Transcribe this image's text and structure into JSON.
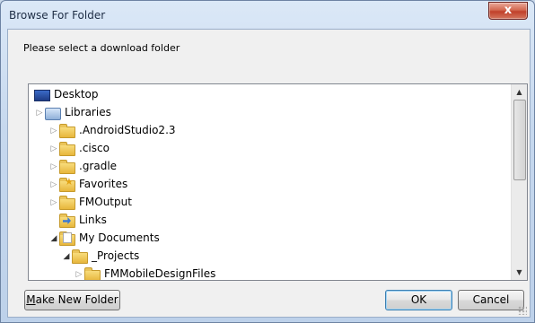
{
  "window": {
    "title": "Browse For Folder",
    "close_label": "x"
  },
  "prompt": "Please select a download folder",
  "tree": {
    "items": [
      {
        "label": "Desktop",
        "icon": "desktop-icon",
        "expander": ""
      },
      {
        "label": "Libraries",
        "icon": "libraries-icon",
        "expander": "▷"
      },
      {
        "label": ".AndroidStudio2.3",
        "icon": "folder-icon",
        "expander": "▷"
      },
      {
        "label": ".cisco",
        "icon": "folder-icon",
        "expander": "▷"
      },
      {
        "label": ".gradle",
        "icon": "folder-icon",
        "expander": "▷"
      },
      {
        "label": "Favorites",
        "icon": "favorites-folder-icon",
        "expander": "▷"
      },
      {
        "label": "FMOutput",
        "icon": "folder-icon",
        "expander": "▷"
      },
      {
        "label": "Links",
        "icon": "links-folder-icon",
        "expander": ""
      },
      {
        "label": "My Documents",
        "icon": "documents-folder-icon",
        "expander": "◢"
      },
      {
        "label": "_Projects",
        "icon": "folder-icon",
        "expander": "◢"
      },
      {
        "label": "FMMobileDesignFiles",
        "icon": "folder-icon",
        "expander": "▷"
      }
    ]
  },
  "buttons": {
    "make_new_folder": "Make New Folder",
    "make_new_folder_underline": "M",
    "make_new_folder_rest": "ake New Folder",
    "ok": "OK",
    "cancel": "Cancel"
  }
}
